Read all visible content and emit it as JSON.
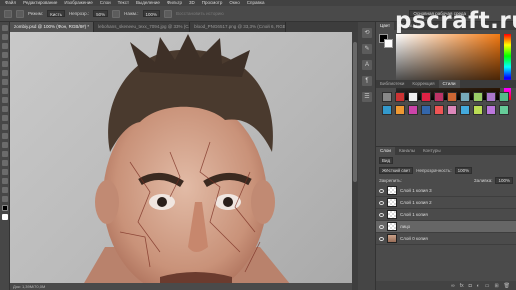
{
  "menubar": [
    "Файл",
    "Редактирование",
    "Изображение",
    "Слои",
    "Текст",
    "Выделение",
    "Фильтр",
    "3D",
    "Просмотр",
    "Окно",
    "Справка"
  ],
  "options": {
    "mode_label": "Режим:",
    "mode_value": "Кисть",
    "opacity_label": "Непрозр.:",
    "opacity_value": "50%",
    "flow_label": "Нажм.:",
    "flow_value": "100%",
    "erase_label": "Восстановить историю",
    "workspace": "Основная рабочая среда"
  },
  "tabs": [
    {
      "label": "zombiy.psd @ 100% (Фон, RGB/8#) *",
      "active": true
    },
    {
      "label": "lebohans_skeneeu_texx_7094.jpg @ 33% (Слой 6, RGB/8)",
      "active": false
    },
    {
      "label": "blood_PNG6517.png @ 33,3% (Слой 6, RGB/8)",
      "active": false
    }
  ],
  "status": "Док: 1,39M/70,0M",
  "panels": {
    "color_tabs": [
      "Цвет",
      "Образцы"
    ],
    "style_tabs": [
      "Библиотеки",
      "Коррекция",
      "Стили"
    ],
    "layer_tabs": [
      "Слои",
      "Каналы",
      "Контуры"
    ],
    "kind_label": "Вид",
    "blend_mode": "Жёсткий свет",
    "opacity_label": "Непрозрачность:",
    "opacity_value": "100%",
    "lock_label": "Закрепить:",
    "fill_label": "Заливка:",
    "fill_value": "100%"
  },
  "layers": [
    {
      "name": "Слой 1 копия 3",
      "selected": false
    },
    {
      "name": "Слой 1 копия 2",
      "selected": false
    },
    {
      "name": "Слой 1 копия",
      "selected": false
    },
    {
      "name": "лицо",
      "selected": true
    },
    {
      "name": "Слой 0 копия",
      "selected": false
    }
  ],
  "watermark": "pscraft.ru",
  "colors": {
    "accent": "#f47a12",
    "panel": "#4b4b4b",
    "menubar": "#424242"
  }
}
